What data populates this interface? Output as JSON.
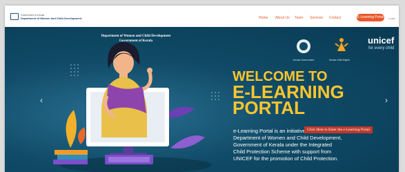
{
  "header": {
    "logo_line1": "Government of Kerala",
    "logo_line2": "Department of Women and Child Development",
    "nav": [
      "Home",
      "About Us",
      "Team",
      "Services",
      "Contact"
    ],
    "login_label": "E-Learning Portal",
    "lang_label": "Login"
  },
  "hero": {
    "dept_line1": "Department of Women and Child Development",
    "dept_line2": "Government of Kerala",
    "welcome_line1": "WELCOME TO",
    "welcome_line2": "E-LEARNING",
    "welcome_line3": "PORTAL",
    "desc_lines": [
      "e-Learning Portal is an initiative of the",
      "Department of Women and Child Development,",
      "Government of Kerala under the Integrated",
      "Child Protection Scheme with support from",
      "UNICEF for the promotion of Child Protection."
    ],
    "tooltip": "Click Here to Enter the e-Learning Portal",
    "partners": [
      "Kerala Government",
      "Kerala Child Rights"
    ],
    "unicef": "unicef",
    "unicef_tagline": "for every child",
    "prev_arrow": "‹",
    "next_arrow": "›"
  },
  "colors": {
    "accent": "#e8582b",
    "hero_bg": "#0f4a66",
    "title": "#ffc52e"
  }
}
